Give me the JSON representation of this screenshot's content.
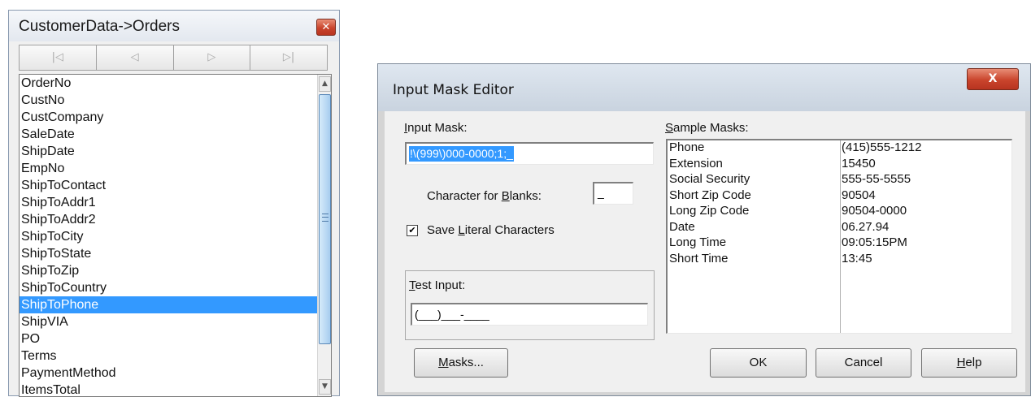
{
  "fields_window": {
    "title": "CustomerData->Orders",
    "close_glyph": "✕",
    "nav_buttons": [
      {
        "icon": "first-record-icon",
        "glyph": "|◁"
      },
      {
        "icon": "prior-record-icon",
        "glyph": "◁"
      },
      {
        "icon": "next-record-icon",
        "glyph": "▷"
      },
      {
        "icon": "last-record-icon",
        "glyph": "▷|"
      }
    ],
    "fields": [
      "OrderNo",
      "CustNo",
      "CustCompany",
      "SaleDate",
      "ShipDate",
      "EmpNo",
      "ShipToContact",
      "ShipToAddr1",
      "ShipToAddr2",
      "ShipToCity",
      "ShipToState",
      "ShipToZip",
      "ShipToCountry",
      "ShipToPhone",
      "ShipVIA",
      "PO",
      "Terms",
      "PaymentMethod",
      "ItemsTotal"
    ],
    "selected_field": "ShipToPhone",
    "scroll_up_glyph": "▲",
    "scroll_down_glyph": "▼"
  },
  "dialog": {
    "title": "Input Mask Editor",
    "close_glyph": "X",
    "input_mask_label": {
      "hot": "I",
      "rest": "nput Mask:"
    },
    "input_mask_value": "!\\(999\\)000-0000;1;_",
    "blanks_label": {
      "pre": "Character for ",
      "hot": "B",
      "rest": "lanks:"
    },
    "blanks_value": "_",
    "save_literals_checked": true,
    "check_glyph": "✔",
    "save_literals_label": {
      "pre": "Save ",
      "hot": "L",
      "rest": "iteral Characters"
    },
    "test_input_label": {
      "hot": "T",
      "rest": "est Input:"
    },
    "test_input_value": "(___)___-____",
    "sample_masks_label": {
      "hot": "S",
      "rest": "ample Masks:"
    },
    "sample_masks": [
      {
        "name": "Phone",
        "value": "(415)555-1212"
      },
      {
        "name": "Extension",
        "value": "15450"
      },
      {
        "name": "Social Security",
        "value": "555-55-5555"
      },
      {
        "name": "Short Zip Code",
        "value": "90504"
      },
      {
        "name": "Long Zip Code",
        "value": "90504-0000"
      },
      {
        "name": "Date",
        "value": "06.27.94"
      },
      {
        "name": "Long Time",
        "value": "09:05:15PM"
      },
      {
        "name": "Short Time",
        "value": "13:45"
      }
    ],
    "buttons": {
      "masks": {
        "hot": "M",
        "rest": "asks..."
      },
      "ok": "OK",
      "cancel": "Cancel",
      "help": {
        "hot": "H",
        "rest": "elp"
      }
    }
  },
  "colors": {
    "selection": "#3399ff",
    "close_button": "#c9442c"
  }
}
